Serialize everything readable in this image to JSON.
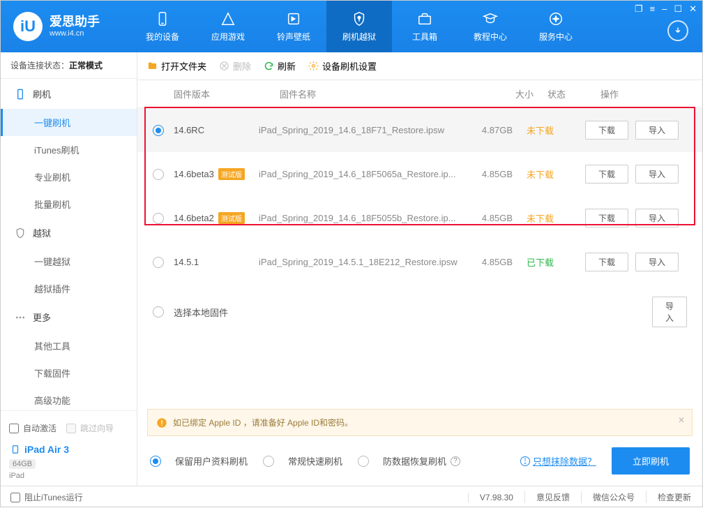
{
  "brand": {
    "name": "爱思助手",
    "url": "www.i4.cn"
  },
  "nav": [
    "我的设备",
    "应用游戏",
    "铃声壁纸",
    "刷机越狱",
    "工具箱",
    "教程中心",
    "服务中心"
  ],
  "deviceStatus": {
    "label": "设备连接状态：",
    "value": "正常模式"
  },
  "sidebar": {
    "g1": "刷机",
    "g1items": [
      "一键刷机",
      "iTunes刷机",
      "专业刷机",
      "批量刷机"
    ],
    "g2": "越狱",
    "g2items": [
      "一键越狱",
      "越狱插件"
    ],
    "g3": "更多",
    "g3items": [
      "其他工具",
      "下载固件",
      "高级功能"
    ]
  },
  "sideFooter": {
    "autoActivate": "自动激活",
    "skipGuide": "跳过向导",
    "deviceName": "iPad Air 3",
    "storage": "64GB",
    "deviceType": "iPad"
  },
  "toolbar": {
    "open": "打开文件夹",
    "delete": "删除",
    "refresh": "刷新",
    "settings": "设备刷机设置"
  },
  "thead": {
    "version": "固件版本",
    "name": "固件名称",
    "size": "大小",
    "status": "状态",
    "action": "操作"
  },
  "rows": [
    {
      "version": "14.6RC",
      "beta": false,
      "name": "iPad_Spring_2019_14.6_18F71_Restore.ipsw",
      "size": "4.87GB",
      "status": "未下载",
      "statusClass": "st-undl",
      "selected": true,
      "download": true
    },
    {
      "version": "14.6beta3",
      "beta": true,
      "name": "iPad_Spring_2019_14.6_18F5065a_Restore.ip...",
      "size": "4.85GB",
      "status": "未下载",
      "statusClass": "st-undl",
      "selected": false,
      "download": true
    },
    {
      "version": "14.6beta2",
      "beta": true,
      "name": "iPad_Spring_2019_14.6_18F5055b_Restore.ip...",
      "size": "4.85GB",
      "status": "未下载",
      "statusClass": "st-undl",
      "selected": false,
      "download": true
    },
    {
      "version": "14.5.1",
      "beta": false,
      "name": "iPad_Spring_2019_14.5.1_18E212_Restore.ipsw",
      "size": "4.85GB",
      "status": "已下载",
      "statusClass": "st-dl",
      "selected": false,
      "download": true
    }
  ],
  "localRow": "选择本地固件",
  "betaLabel": "测试版",
  "btns": {
    "download": "下载",
    "import": "导入"
  },
  "alert": "如已绑定 Apple ID ，请准备好 Apple ID和密码。",
  "options": {
    "keep": "保留用户资料刷机",
    "normal": "常规快速刷机",
    "antiRecover": "防数据恢复刷机",
    "eraseOnly": "只想抹除数据？",
    "flash": "立即刷机"
  },
  "statusbar": {
    "stopItunes": "阻止iTunes运行",
    "version": "V7.98.30",
    "feedback": "意见反馈",
    "wechat": "微信公众号",
    "checkUpdate": "检查更新"
  }
}
